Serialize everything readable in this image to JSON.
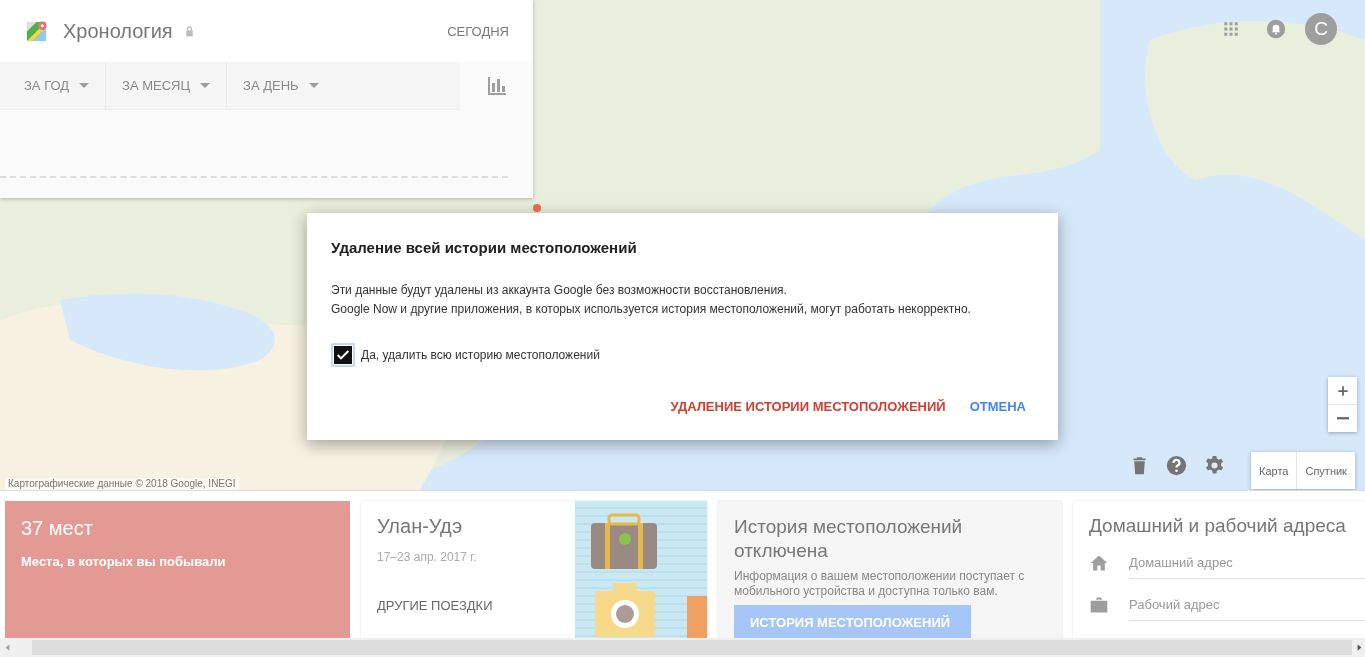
{
  "timeline": {
    "title": "Хронология",
    "today": "СЕГОДНЯ",
    "filters": [
      {
        "label": "ЗА ГОД"
      },
      {
        "label": "ЗА МЕСЯЦ"
      },
      {
        "label": "ЗА ДЕНЬ"
      }
    ]
  },
  "account": {
    "avatar_letter": "С"
  },
  "map": {
    "attribution": "Картографические данные © 2018 Google, INEGI",
    "map_types": [
      {
        "label": "Карта"
      },
      {
        "label": "Спутник"
      }
    ]
  },
  "dialog": {
    "title": "Удаление всей истории местоположений",
    "body": [
      "Эти данные будут удалены из аккаунта Google без возможности восстановления.",
      "Google Now и другие приложения, в которых используется история местоположений, могут работать некорректно."
    ],
    "checkbox": {
      "label": "Да, удалить всю историю местоположений",
      "checked": true
    },
    "buttons": [
      {
        "label": "УДАЛЕНИЕ ИСТОРИИ МЕСТОПОЛОЖЕНИЙ",
        "kind": "danger"
      },
      {
        "label": "ОТМЕНА",
        "kind": "primary"
      }
    ]
  },
  "cards": [
    {
      "kind": "places",
      "title": "37 мест",
      "subtitle": "Места, в которых вы побывали"
    },
    {
      "kind": "trip",
      "title": "Улан-Удэ",
      "dates": "17–23 апр. 2017 г.",
      "link": "ДРУГИЕ ПОЕЗДКИ"
    },
    {
      "kind": "history",
      "title": "История местоположений отключена",
      "text": "Информация о вашем местоположении поступает с мобильного устройства и доступна только вам.",
      "button": "ИСТОРИЯ МЕСТОПОЛОЖЕНИЙ"
    },
    {
      "kind": "addresses",
      "title": "Домашний и рабочий адреса",
      "fields": [
        {
          "placeholder": "Домашний адрес"
        },
        {
          "placeholder": "Рабочий адрес"
        }
      ]
    }
  ]
}
